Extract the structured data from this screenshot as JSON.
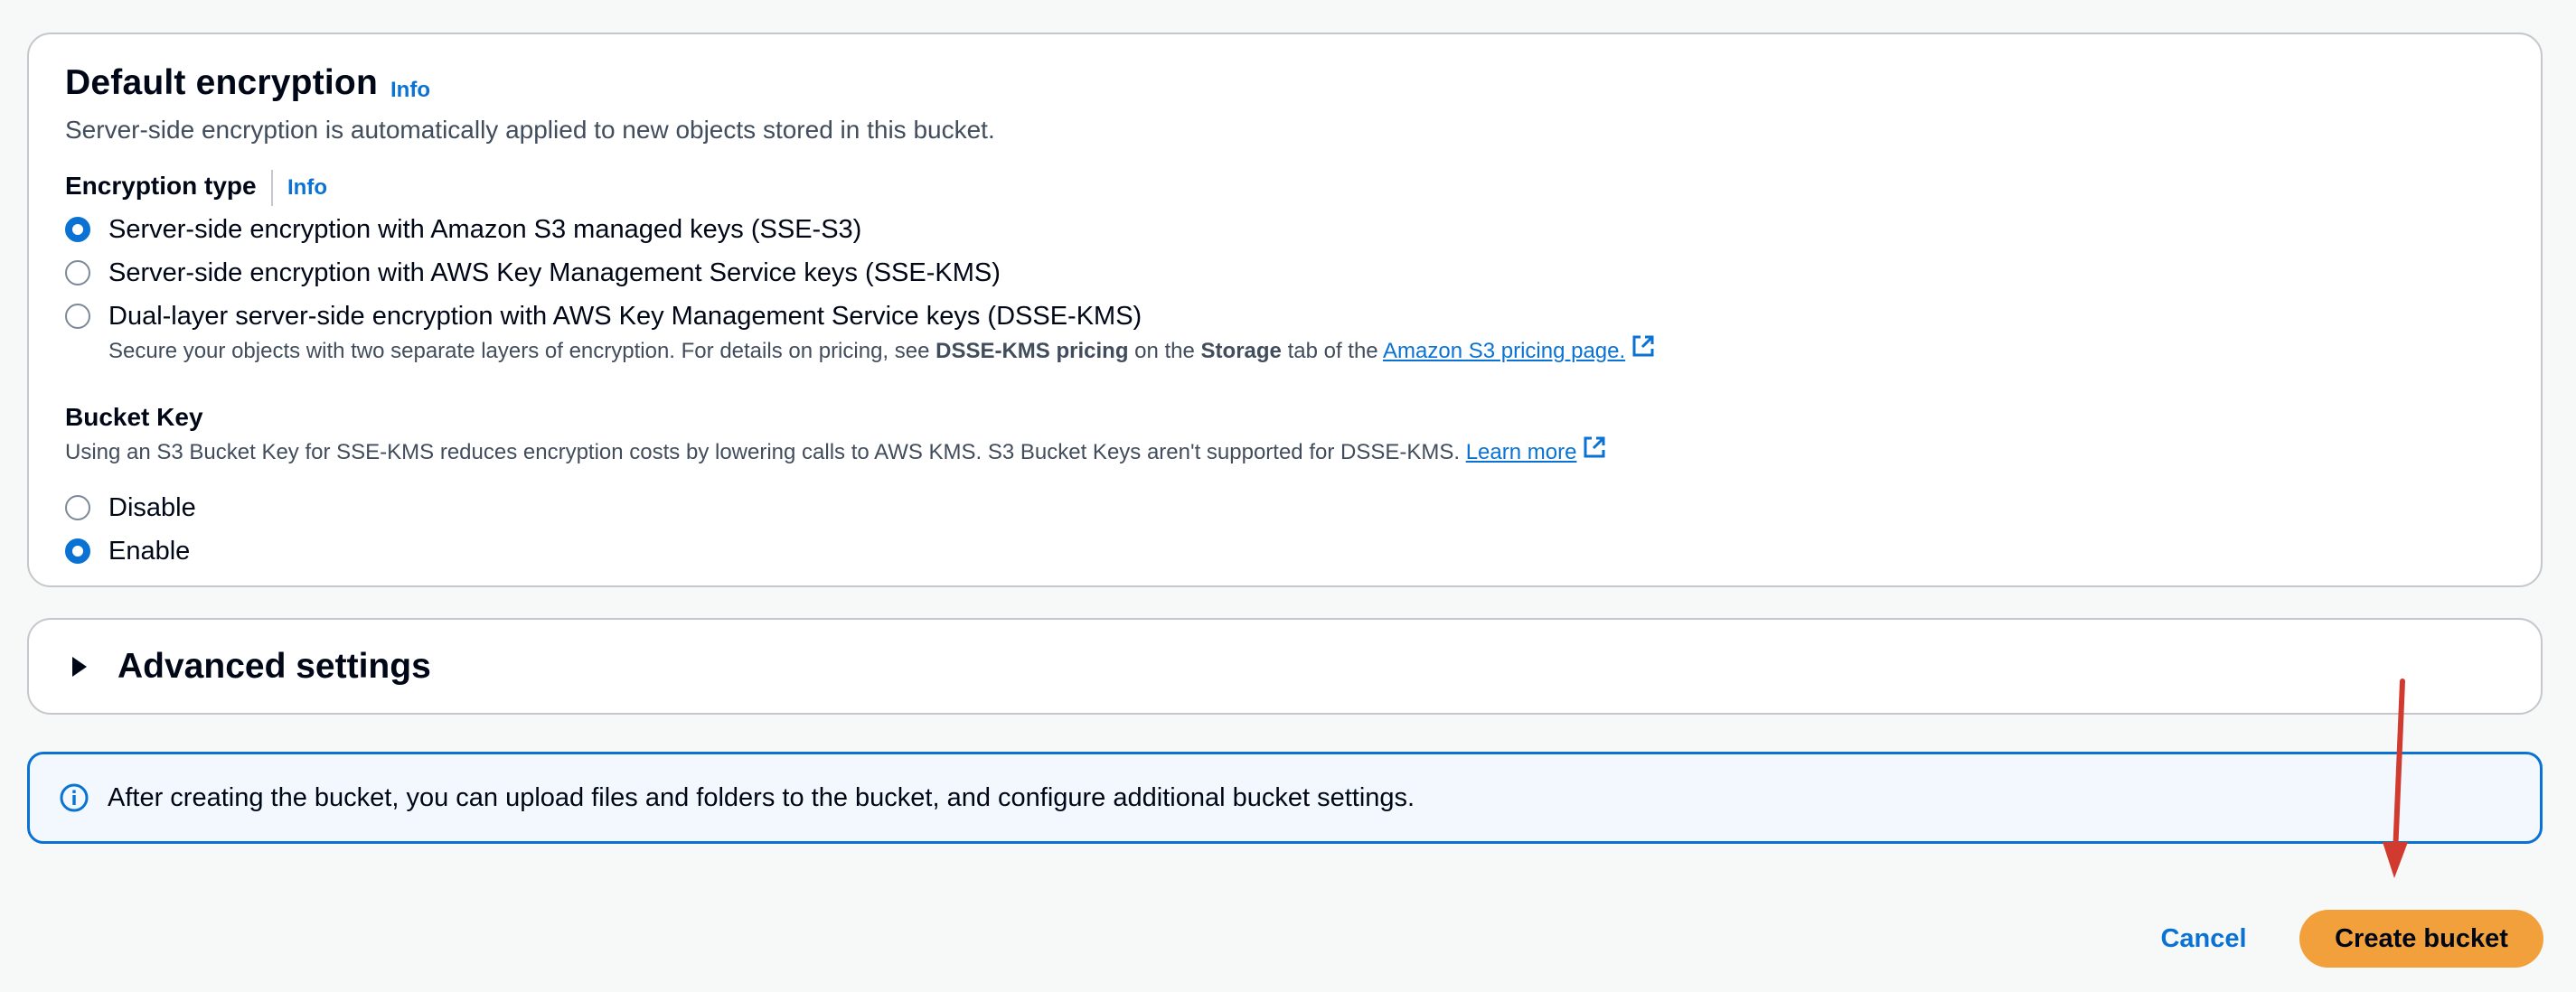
{
  "encryption": {
    "title": "Default encryption",
    "info_label": "Info",
    "description": "Server-side encryption is automatically applied to new objects stored in this bucket.",
    "type_label": "Encryption type",
    "type_info_label": "Info",
    "options": [
      {
        "label": "Server-side encryption with Amazon S3 managed keys (SSE-S3)",
        "selected": true
      },
      {
        "label": "Server-side encryption with AWS Key Management Service keys (SSE-KMS)",
        "selected": false
      },
      {
        "label": "Dual-layer server-side encryption with AWS Key Management Service keys (DSSE-KMS)",
        "selected": false
      }
    ],
    "dsse_help": {
      "prefix": "Secure your objects with two separate layers of encryption. For details on pricing, see ",
      "bold1": "DSSE-KMS pricing",
      "mid": " on the ",
      "bold2": "Storage",
      "suffix": " tab of the ",
      "link": "Amazon S3 pricing page."
    }
  },
  "bucket_key": {
    "label": "Bucket Key",
    "description": "Using an S3 Bucket Key for SSE-KMS reduces encryption costs by lowering calls to AWS KMS. S3 Bucket Keys aren't supported for DSSE-KMS.",
    "learn_more": "Learn more",
    "options": [
      {
        "label": "Disable",
        "selected": false
      },
      {
        "label": "Enable",
        "selected": true
      }
    ]
  },
  "advanced": {
    "title": "Advanced settings"
  },
  "alert": {
    "text": "After creating the bucket, you can upload files and folders to the bucket, and configure additional bucket settings."
  },
  "actions": {
    "cancel": "Cancel",
    "create": "Create bucket"
  },
  "colors": {
    "accent": "#0972d3",
    "primary_button": "#f1a03b",
    "annotation_arrow": "#d13a2f"
  }
}
